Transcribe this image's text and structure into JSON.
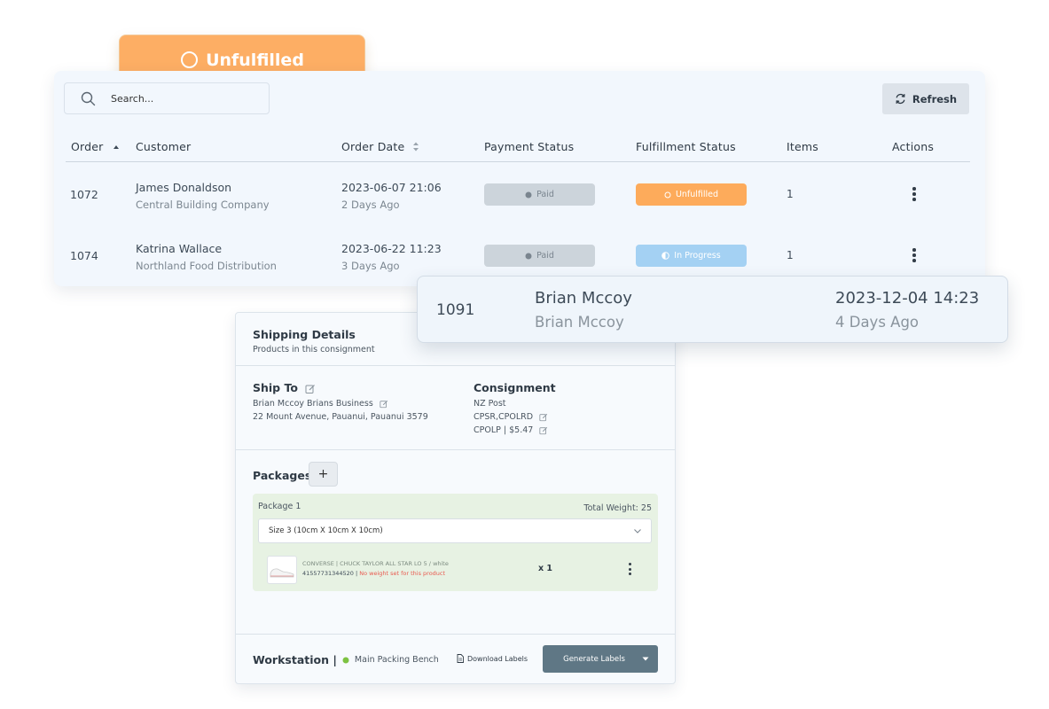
{
  "badge": {
    "label": "Unfulfilled"
  },
  "search": {
    "placeholder": "Search..."
  },
  "toolbar": {
    "refresh_label": "Refresh"
  },
  "table": {
    "columns": [
      "Order",
      "Customer",
      "Order Date",
      "Payment Status",
      "Fulfillment Status",
      "Items",
      "Actions"
    ],
    "rows": [
      {
        "order": "1072",
        "customer": "James Donaldson",
        "company": "Central Building Company",
        "date": "2023-06-07 21:06",
        "ago": "2 Days Ago",
        "payment": "Paid",
        "fulfillment": "Unfulfilled",
        "items": "1"
      },
      {
        "order": "1074",
        "customer": "Katrina Wallace",
        "company": "Northland Food Distribution",
        "date": "2023-06-22 11:23",
        "ago": "3 Days Ago",
        "payment": "Paid",
        "fulfillment": "In Progress",
        "items": "1"
      }
    ]
  },
  "highlight_row": {
    "order": "1091",
    "customer": "Brian Mccoy",
    "company": "Brian Mccoy",
    "date": "2023-12-04 14:23",
    "ago": "4 Days Ago"
  },
  "shipping": {
    "title": "Shipping Details",
    "subtitle": "Products in this consignment",
    "ship_to_title": "Ship To",
    "ship_to_name": "Brian Mccoy Brians Business",
    "ship_to_address": "22 Mount Avenue, Pauanui, Pauanui 3579",
    "consignment_title": "Consignment",
    "carrier": "NZ Post",
    "service": "CPSR,CPOLRD",
    "rate": "CPOLP | $5.47",
    "packages_title": "Packages",
    "add_label": "+",
    "package_name": "Package 1",
    "total_weight": "Total Weight: 25",
    "size_selected": "Size 3 (10cm X 10cm X 10cm)",
    "product_name": "CONVERSE | CHUCK TAYLOR ALL STAR LO 5 / white",
    "product_sku": "41557731344520 |",
    "product_warning": "No weight set for this product",
    "product_qty": "x 1",
    "workstation_label": "Workstation |",
    "workstation_name": "Main Packing Bench",
    "download_label": "Download Labels",
    "generate_label": "Generate Labels"
  },
  "colors": {
    "orange": "#fdab5b",
    "blue": "#a4d1f3",
    "paid": "#ccd4db",
    "slate_button": "#5f7785",
    "package_bg": "#e7f2e3",
    "warning": "#e85a4f",
    "online": "#7dc242"
  }
}
